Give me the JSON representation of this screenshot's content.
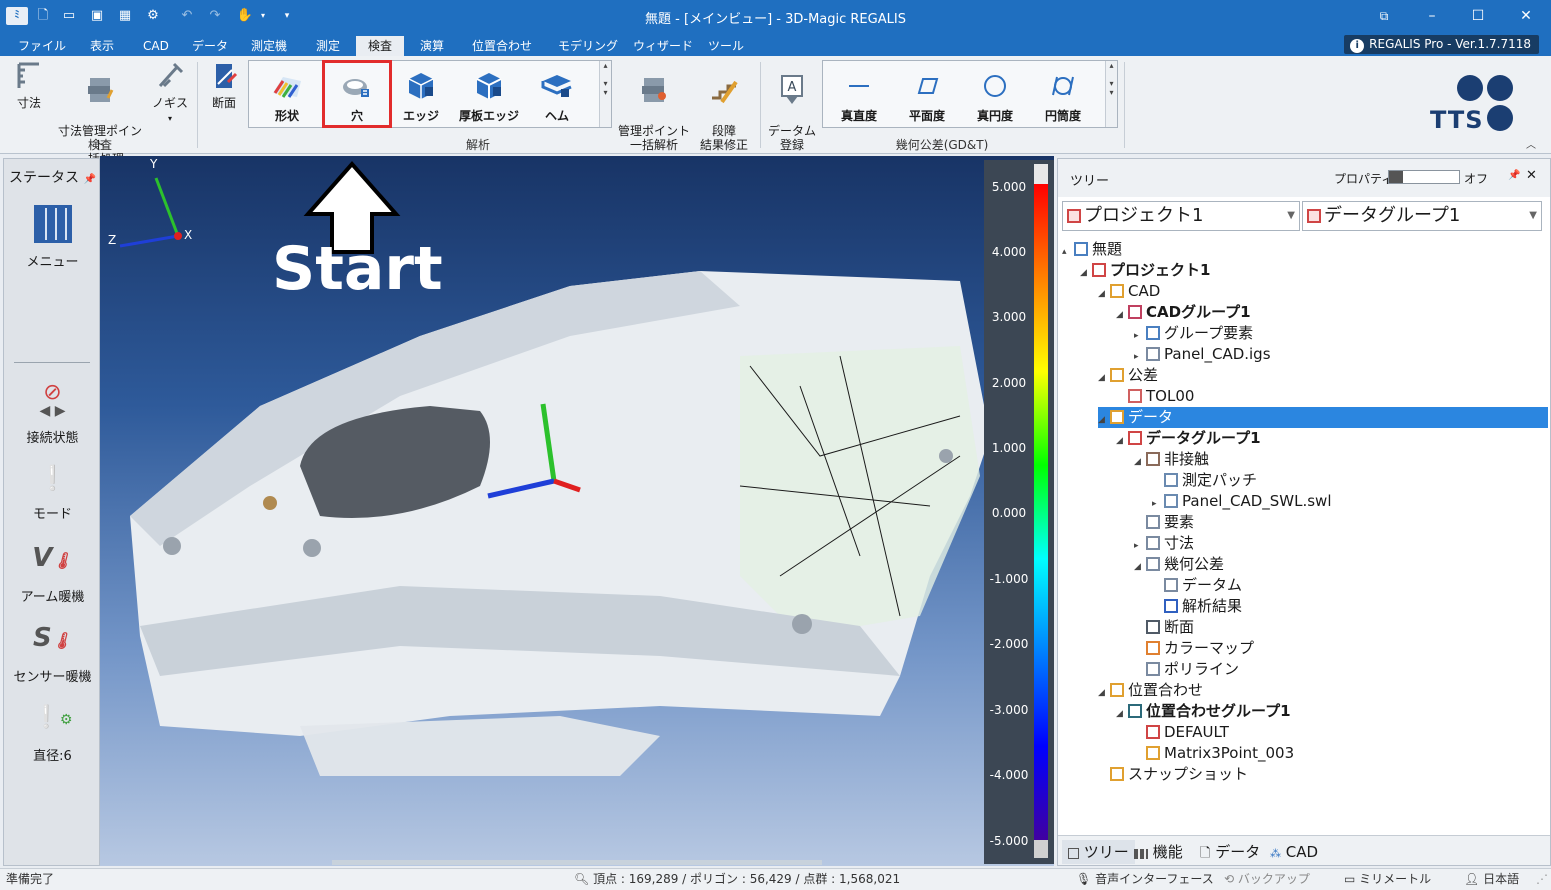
{
  "window": {
    "title": "無題 - [メインビュー] - 3D-Magic REGALIS",
    "version_badge": "REGALIS Pro - Ver.1.7.7118",
    "quick_access": [
      "app-icon",
      "new-icon",
      "open-icon",
      "save-icon",
      "grid-icon",
      "gear-icon",
      "undo-icon",
      "redo-icon",
      "hand-icon",
      "dropdown-icon"
    ]
  },
  "menu": {
    "tabs": [
      "ファイル",
      "表示",
      "CAD",
      "データ",
      "測定機",
      "測定",
      "検査",
      "演算",
      "位置合わせ",
      "モデリング",
      "ウィザード",
      "ツール"
    ],
    "active": "検査"
  },
  "ribbon": {
    "group_inspection": {
      "label": "検査",
      "buttons": [
        "寸法",
        "寸法管理ポイント\n一括処理",
        "ノギス"
      ]
    },
    "group_analysis": {
      "label": "解析",
      "section_button": "断面",
      "gallery": [
        "形状",
        "穴",
        "エッジ",
        "厚板エッジ",
        "ヘム"
      ],
      "buttons": [
        "管理ポイント\n一括解析",
        "段障\n結果修正"
      ]
    },
    "group_gdt": {
      "label": "幾何公差(GD&T)",
      "datum_button": "データム\n登録",
      "gallery": [
        "真直度",
        "平面度",
        "真円度",
        "円筒度"
      ]
    },
    "logo": "TTS",
    "collapse_icon": "chevron-up-icon"
  },
  "status_panel": {
    "title": "ステータス",
    "items": [
      "メニュー",
      "接続状態",
      "モード",
      "アーム暖機",
      "センサー暖機",
      "直径:6"
    ]
  },
  "viewport": {
    "annotation": "Start",
    "axes": {
      "y": "Y",
      "x": "X",
      "z": "Z"
    },
    "colorbar_ticks": [
      "5.000",
      "4.000",
      "3.000",
      "2.000",
      "1.000",
      "0.000",
      "-1.000",
      "-2.000",
      "-3.000",
      "-4.000",
      "-5.000"
    ]
  },
  "right_panel": {
    "title": "ツリー",
    "property_label": "プロパティ",
    "toggle_state": "オフ",
    "project_combo": "プロジェクト1",
    "group_combo": "データグループ1",
    "tree": [
      {
        "label": "無題",
        "level": 0,
        "twisty": "▴",
        "bold": false,
        "icon": "globe-icon",
        "color": "#4a7fc0"
      },
      {
        "label": "プロジェクト1",
        "level": 1,
        "twisty": "◢",
        "bold": true,
        "icon": "project-icon",
        "color": "#d04545"
      },
      {
        "label": "CAD",
        "level": 2,
        "twisty": "◢",
        "bold": false,
        "icon": "cad-folder-icon",
        "color": "#e0a030"
      },
      {
        "label": "CADグループ1",
        "level": 3,
        "twisty": "◢",
        "bold": true,
        "icon": "cad-group-icon",
        "color": "#c04060"
      },
      {
        "label": "グループ要素",
        "level": 4,
        "twisty": "▸",
        "bold": false,
        "icon": "group-elements-icon",
        "color": "#4a7fc0"
      },
      {
        "label": "Panel_CAD.igs",
        "level": 4,
        "twisty": "▸",
        "bold": false,
        "icon": "cad-model-icon",
        "color": "#7a8aa0"
      },
      {
        "label": "公差",
        "level": 2,
        "twisty": "◢",
        "bold": false,
        "icon": "tolerance-folder-icon",
        "color": "#e0a030"
      },
      {
        "label": "TOL00",
        "level": 3,
        "twisty": "",
        "bold": false,
        "icon": "tolerance-icon",
        "color": "#d06060"
      },
      {
        "label": "データ",
        "level": 2,
        "twisty": "◢",
        "bold": false,
        "icon": "data-folder-icon",
        "color": "#e0a030",
        "selected": true
      },
      {
        "label": "データグループ1",
        "level": 3,
        "twisty": "◢",
        "bold": true,
        "icon": "data-group-icon",
        "color": "#d04545"
      },
      {
        "label": "非接触",
        "level": 4,
        "twisty": "◢",
        "bold": false,
        "icon": "scanner-icon",
        "color": "#8a6a5a"
      },
      {
        "label": "測定パッチ",
        "level": 5,
        "twisty": "",
        "bold": false,
        "icon": "patch-icon",
        "color": "#6a8ab0"
      },
      {
        "label": "Panel_CAD_SWL.swl",
        "level": 5,
        "twisty": "▸",
        "bold": false,
        "icon": "point-cloud-icon",
        "color": "#6a8ab0"
      },
      {
        "label": "要素",
        "level": 4,
        "twisty": "",
        "bold": false,
        "icon": "element-icon",
        "color": "#7a8aa0"
      },
      {
        "label": "寸法",
        "level": 4,
        "twisty": "▸",
        "bold": false,
        "icon": "dimension-icon",
        "color": "#7a8aa0"
      },
      {
        "label": "幾何公差",
        "level": 4,
        "twisty": "◢",
        "bold": false,
        "icon": "gdt-icon",
        "color": "#7a8aa0"
      },
      {
        "label": "データム",
        "level": 5,
        "twisty": "",
        "bold": false,
        "icon": "datum-icon",
        "color": "#7a8aa0"
      },
      {
        "label": "解析結果",
        "level": 5,
        "twisty": "",
        "bold": false,
        "icon": "analysis-result-icon",
        "color": "#3060c0"
      },
      {
        "label": "断面",
        "level": 4,
        "twisty": "",
        "bold": false,
        "icon": "section-icon",
        "color": "#505a66"
      },
      {
        "label": "カラーマップ",
        "level": 4,
        "twisty": "",
        "bold": false,
        "icon": "colormap-icon",
        "color": "#e08030"
      },
      {
        "label": "ポリライン",
        "level": 4,
        "twisty": "",
        "bold": false,
        "icon": "polyline-icon",
        "color": "#7a8aa0"
      },
      {
        "label": "位置合わせ",
        "level": 2,
        "twisty": "◢",
        "bold": false,
        "icon": "alignment-folder-icon",
        "color": "#e0a030"
      },
      {
        "label": "位置合わせグループ1",
        "level": 3,
        "twisty": "◢",
        "bold": true,
        "icon": "alignment-group-icon",
        "color": "#2c6a7a"
      },
      {
        "label": "DEFAULT",
        "level": 4,
        "twisty": "",
        "bold": false,
        "icon": "default-icon",
        "color": "#d04545"
      },
      {
        "label": "Matrix3Point_003",
        "level": 4,
        "twisty": "",
        "bold": false,
        "icon": "matrix-icon",
        "color": "#e0a030"
      },
      {
        "label": "スナップショット",
        "level": 2,
        "twisty": "",
        "bold": false,
        "icon": "snapshot-icon",
        "color": "#e0a030"
      }
    ],
    "bottom_tabs": [
      "ツリー",
      "機能",
      "データ",
      "CAD"
    ],
    "active_bottom_tab": "ツリー"
  },
  "statusbar": {
    "left": "準備完了",
    "counts": "頂点 : 169,289 / ポリゴン : 56,429 / 点群 : 1,568,021",
    "voice": "音声インターフェース",
    "backup": "バックアップ",
    "unit": "ミリメートル",
    "language": "日本語"
  }
}
